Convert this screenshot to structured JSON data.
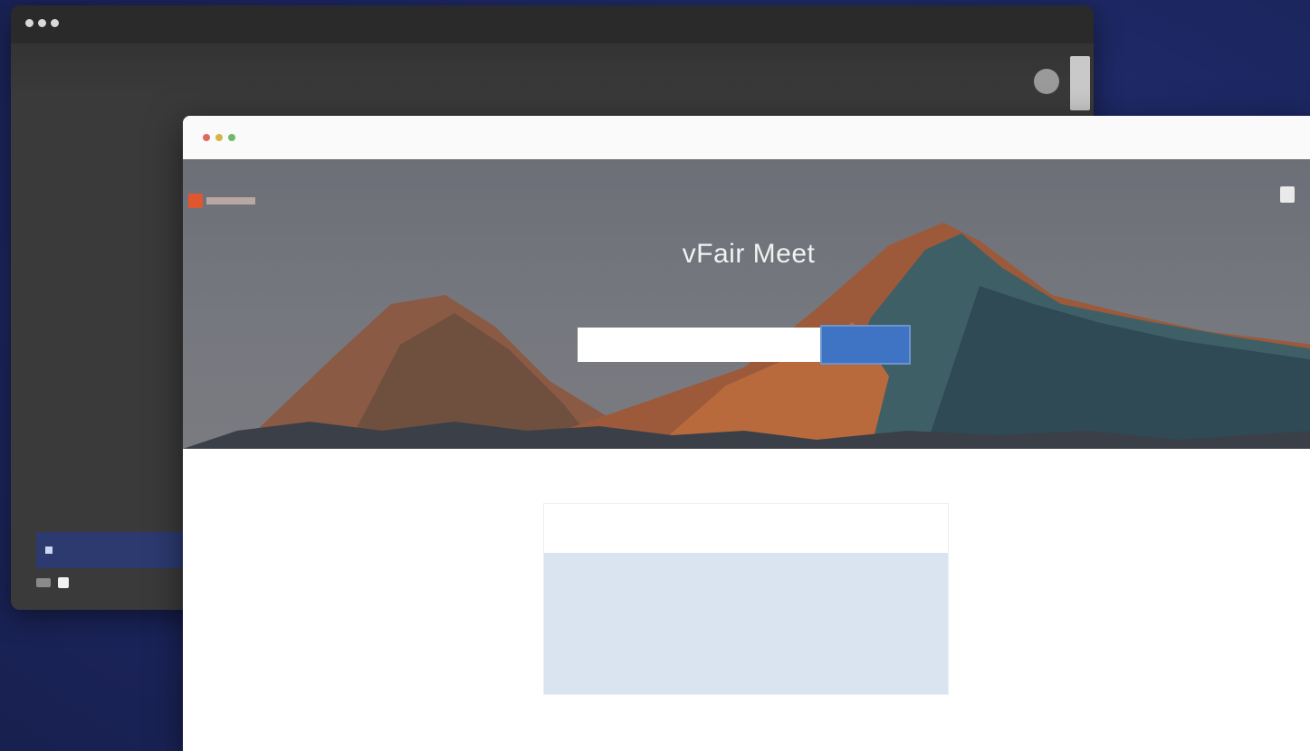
{
  "back_window": {
    "title": "",
    "subtitle": "",
    "bottom_bar_text": ""
  },
  "browser": {
    "hero": {
      "title": "vFair Meet",
      "subtitle": "",
      "input_value": "",
      "join_button": ""
    },
    "meetings_card": {
      "tabs": [
        {
          "label": "",
          "sub": ""
        },
        {
          "label": "",
          "sub": ""
        }
      ]
    }
  },
  "colors": {
    "page_background": "#1f2a6b",
    "accent_blue": "#3f74c4",
    "panel_blue": "#dae4f0",
    "back_window": "#3a3a3a"
  }
}
